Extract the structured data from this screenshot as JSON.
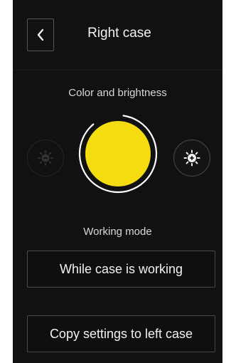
{
  "header": {
    "title": "Right case",
    "back_icon": "chevron-left-icon"
  },
  "color": {
    "label": "Color and brightness",
    "selected_color": "#f5dc10",
    "dim_icon": "brightness-decrease-icon",
    "bright_icon": "brightness-increase-icon"
  },
  "mode": {
    "label": "Working mode",
    "value": "While case is working"
  },
  "copy": {
    "label": "Copy settings to left case"
  },
  "colors": {
    "background": "#0d0d0d",
    "text": "#f2f2f2",
    "border": "#4a4a4a"
  }
}
